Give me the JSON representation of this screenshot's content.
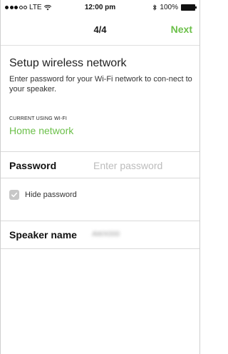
{
  "status_bar": {
    "carrier": "LTE",
    "time": "12:00 pm",
    "battery": "100%"
  },
  "nav": {
    "title": "4/4",
    "next_label": "Next"
  },
  "setup": {
    "heading": "Setup wireless network",
    "description": "Enter password for your Wi-Fi network to con-nect to your speaker."
  },
  "current_wifi": {
    "label": "CURRENT USING WI-FI",
    "value": "Home network"
  },
  "password": {
    "label": "Password",
    "placeholder": "Enter password",
    "value": ""
  },
  "hide_password": {
    "label": "Hide password",
    "checked": true
  },
  "speaker": {
    "label": "Speaker name",
    "value": "AWX000"
  },
  "colors": {
    "accent": "#6cc04a",
    "checkbox": "#c7c7c7"
  }
}
